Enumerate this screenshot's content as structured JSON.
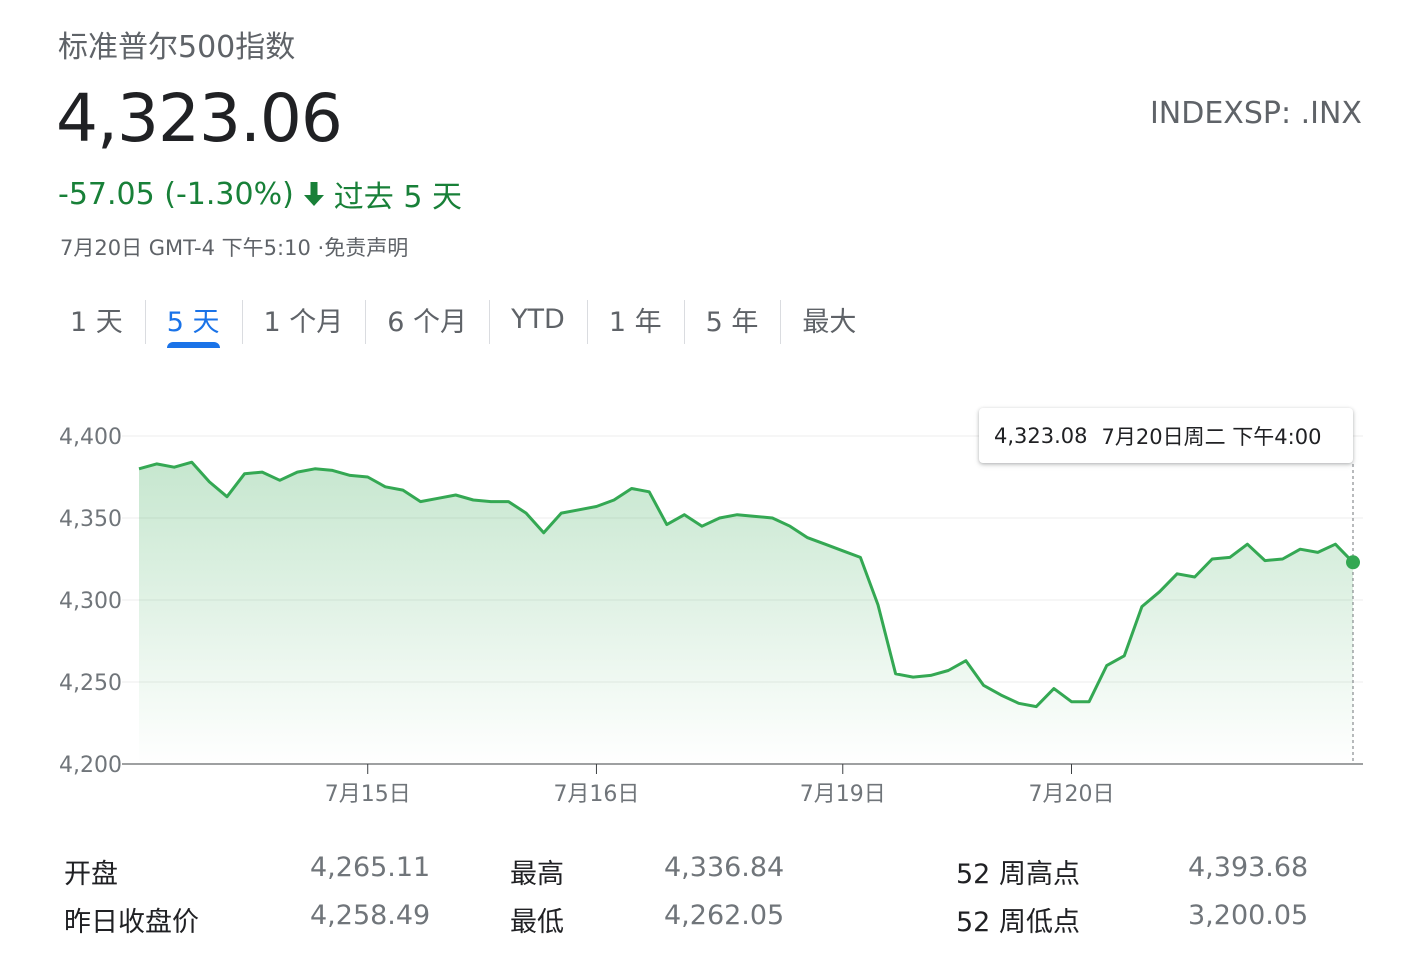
{
  "header": {
    "index_name": "标准普尔500指数",
    "price": "4,323.06",
    "ticker": "INDEXSP: .INX",
    "change": "-57.05 (-1.30%)",
    "change_direction_icon": "arrow-down-icon",
    "period": "过去 5 天",
    "timestamp": "7月20日 GMT-4 下午5:10",
    "disclaimer": "·免责声明"
  },
  "colors": {
    "positive_green": "#188038",
    "line_green": "#34a853",
    "active_tab_blue": "#1a73e8"
  },
  "tabs": [
    {
      "label": "1 天",
      "active": false
    },
    {
      "label": "5 天",
      "active": true
    },
    {
      "label": "1 个月",
      "active": false
    },
    {
      "label": "6 个月",
      "active": false
    },
    {
      "label": "YTD",
      "active": false
    },
    {
      "label": "1 年",
      "active": false
    },
    {
      "label": "5 年",
      "active": false
    },
    {
      "label": "最大",
      "active": false
    }
  ],
  "tooltip": {
    "value": "4,323.08",
    "date": "7月20日周二 下午4:00"
  },
  "chart_data": {
    "type": "area",
    "title": "",
    "xlabel": "",
    "ylabel": "",
    "ylim": [
      4200,
      4400
    ],
    "yticks": [
      "4,400",
      "4,350",
      "4,300",
      "4,250",
      "4,200"
    ],
    "ytick_values": [
      4400,
      4350,
      4300,
      4250,
      4200
    ],
    "x_tick_labels": [
      "7月15日",
      "7月16日",
      "7月19日",
      "7月20日"
    ],
    "x_tick_positions": [
      13,
      26,
      40,
      53
    ],
    "grid": true,
    "series": [
      {
        "values": [
          4380,
          4383,
          4381,
          4384,
          4372,
          4363,
          4377,
          4378,
          4373,
          4378,
          4380,
          4379,
          4376,
          4375,
          4369,
          4367,
          4360,
          4362,
          4364,
          4361,
          4360,
          4360,
          4353,
          4341,
          4353,
          4355,
          4357,
          4361,
          4368,
          4366,
          4346,
          4352,
          4345,
          4350,
          4352,
          4351,
          4350,
          4345,
          4338,
          4334,
          4330,
          4326,
          4297,
          4255,
          4253,
          4254,
          4257,
          4263,
          4248,
          4242,
          4237,
          4235,
          4246,
          4238,
          4238,
          4260,
          4266,
          4296,
          4305,
          4316,
          4314,
          4325,
          4326,
          4334,
          4324,
          4325,
          4331,
          4329,
          4334,
          4323
        ]
      }
    ]
  },
  "stats": {
    "open_label": "开盘",
    "open_value": "4,265.11",
    "prev_close_label": "昨日收盘价",
    "prev_close_value": "4,258.49",
    "high_label": "最高",
    "high_value": "4,336.84",
    "low_label": "最低",
    "low_value": "4,262.05",
    "wk52_high_label": "52 周高点",
    "wk52_high_value": "4,393.68",
    "wk52_low_label": "52 周低点",
    "wk52_low_value": "3,200.05"
  }
}
